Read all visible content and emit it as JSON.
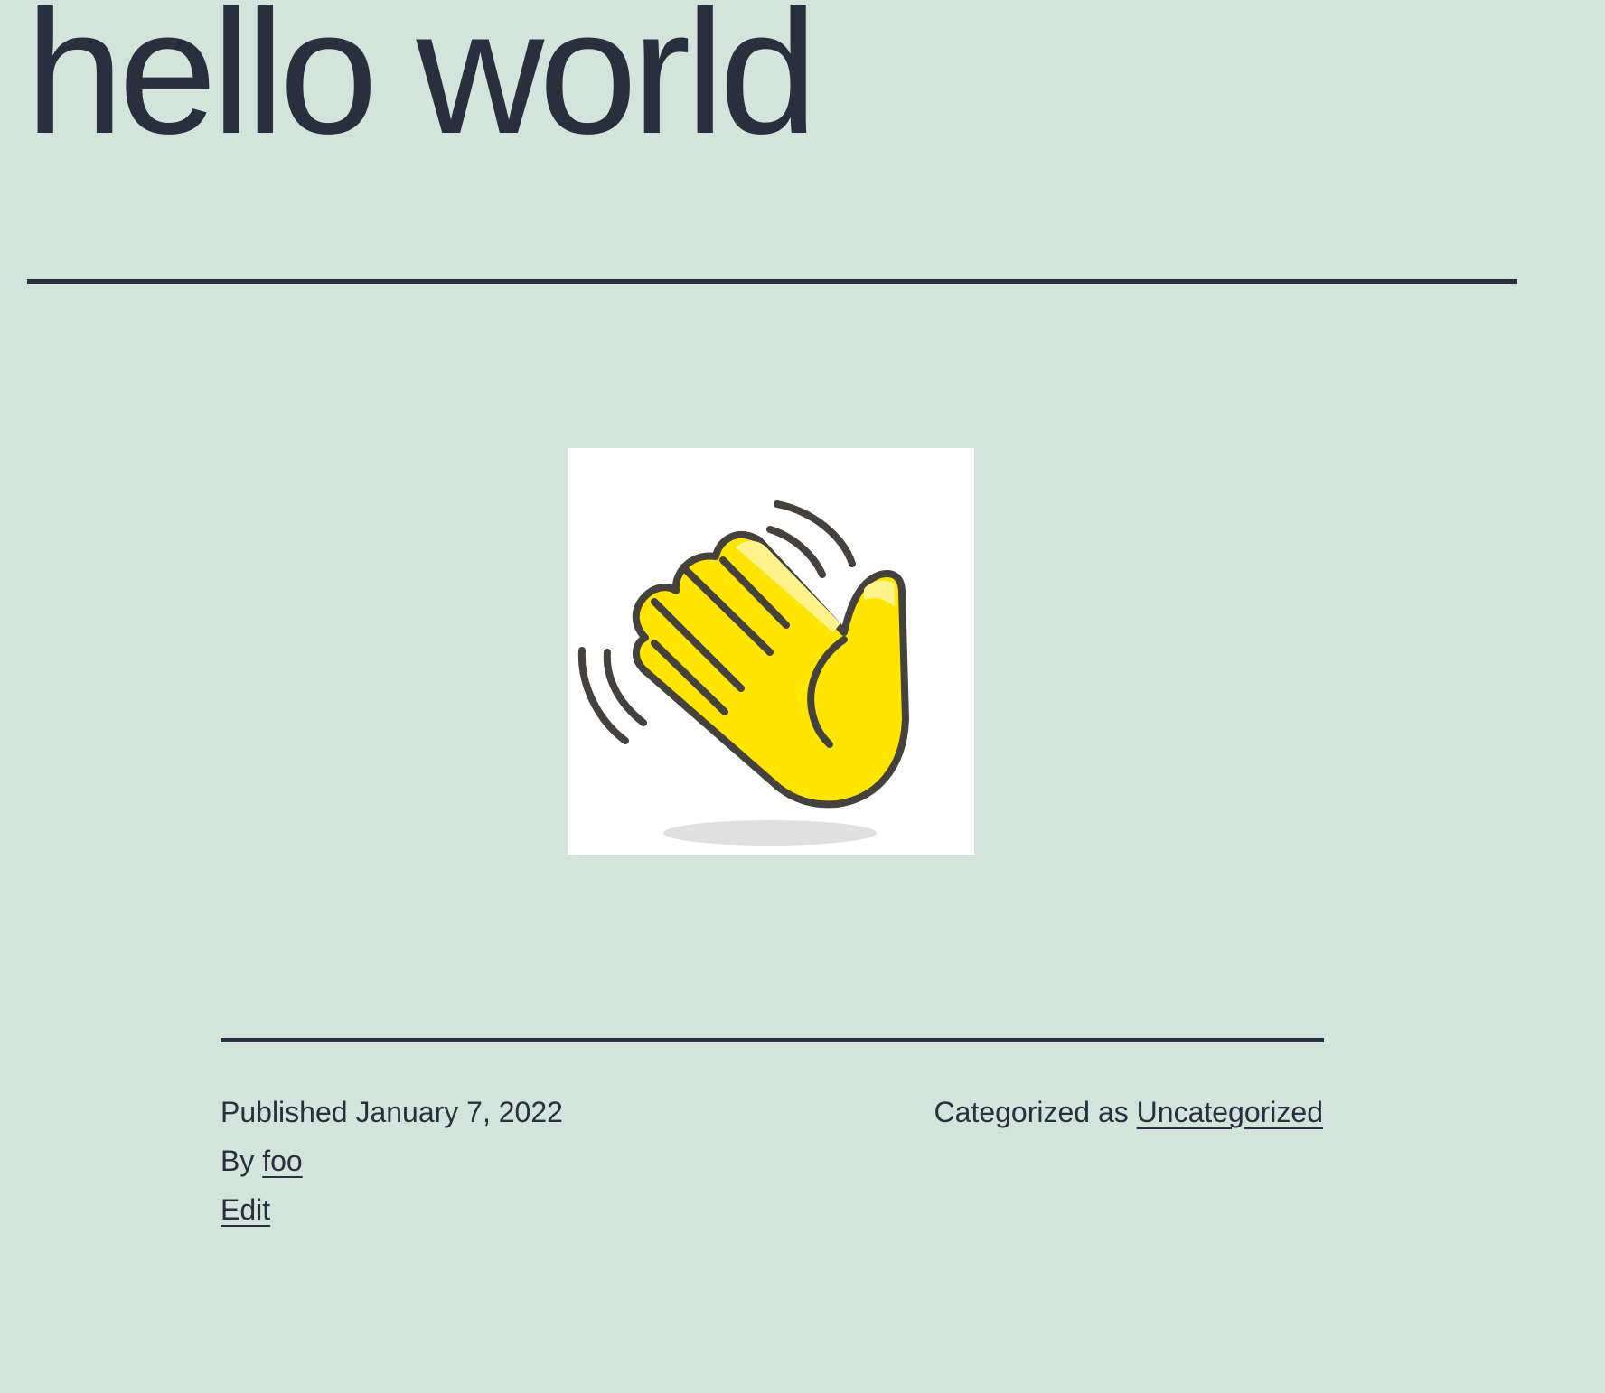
{
  "post": {
    "title": "hello world",
    "image": {
      "icon": "waving-hand-icon",
      "colors": {
        "hand": "#ffe500",
        "highlight": "#fff48c",
        "outline": "#45413c",
        "shadow": "#e0e0e0",
        "background": "#ffffff"
      }
    }
  },
  "meta": {
    "published_prefix": "Published",
    "published_date": "January 7, 2022",
    "by_prefix": "By",
    "author": "foo",
    "edit_label": "Edit",
    "categorized_prefix": "Categorized as",
    "category": "Uncategorized"
  },
  "theme": {
    "background": "#d3e4dd",
    "text": "#28303d"
  }
}
